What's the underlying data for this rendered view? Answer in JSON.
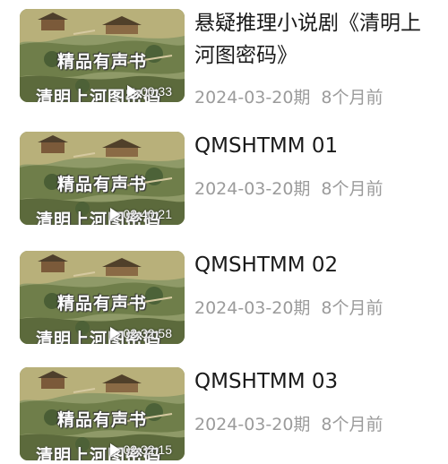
{
  "episodes": [
    {
      "title": "悬疑推理小说剧《清明上河图密码》",
      "date": "2024-03-20期",
      "age": "8个月前",
      "duration": "00:33",
      "cover_title": "精品有声书",
      "cover_subtitle": "清明上河图密码"
    },
    {
      "title": "QMSHTMM 01",
      "date": "2024-03-20期",
      "age": "8个月前",
      "duration": "02:40:21",
      "cover_title": "精品有声书",
      "cover_subtitle": "清明上河图密码"
    },
    {
      "title": "QMSHTMM 02",
      "date": "2024-03-20期",
      "age": "8个月前",
      "duration": "02:32:58",
      "cover_title": "精品有声书",
      "cover_subtitle": "清明上河图密码"
    },
    {
      "title": "QMSHTMM 03",
      "date": "2024-03-20期",
      "age": "8个月前",
      "duration": "02:32:15",
      "cover_title": "精品有声书",
      "cover_subtitle": "清明上河图密码"
    }
  ],
  "icons": {
    "play": "play-icon"
  },
  "colors": {
    "title_text": "#1a1a1a",
    "meta_text": "#9b9b9b",
    "background": "#ffffff"
  }
}
